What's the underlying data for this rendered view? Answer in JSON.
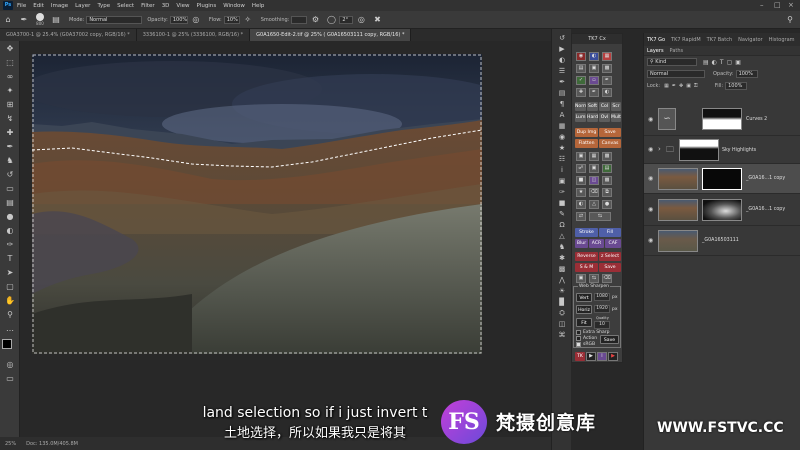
{
  "menu": {
    "items": [
      "File",
      "Edit",
      "Image",
      "Layer",
      "Type",
      "Select",
      "Filter",
      "3D",
      "View",
      "Plugins",
      "Window",
      "Help"
    ]
  },
  "options": {
    "mode_label": "Mode:",
    "mode_value": "Normal",
    "opacity_label": "Opacity:",
    "opacity_value": "100%",
    "flow_label": "Flow:",
    "flow_value": "10%",
    "smoothing_label": "Smoothing:",
    "angle_value": "2°",
    "brush_size": "800"
  },
  "tabs": [
    {
      "label": "G0A3700-1 @ 25.4% (G0A37002 copy, RGB/16) *",
      "active": false
    },
    {
      "label": "3336100-1 @ 25% (3336100, RGB/16) *",
      "active": false
    },
    {
      "label": "G0A1650-Edit-2.tif @ 25% ( G0A16503111 copy, RGB/16) *",
      "active": true
    }
  ],
  "status": {
    "zoom": "25%",
    "doc": "Doc: 135.0M/405.8M"
  },
  "subtitles": {
    "en": "land selection so if i just invert t",
    "zh": "土地选择，所以如果我只是将其"
  },
  "tk_cx": {
    "title": "TK7 Cx",
    "rows": [
      [
        "Norm",
        "Soft",
        "Col",
        "Scr"
      ],
      [
        "Lum",
        "Hard",
        "Ovl",
        "Mult"
      ]
    ],
    "dup_img": "Dup Img",
    "save_btn": "Save",
    "flatten": "Flatten",
    "canvas": "Canvas",
    "stroke": "Stroke",
    "fill": "Fill",
    "blur": "Blur",
    "acr": "ACR",
    "caf": "CAF",
    "reverse": "Reverse",
    "z_select": "z Select",
    "sm": "S & M",
    "save2": "Save"
  },
  "web_sharpen": {
    "title": "Web Sharpen",
    "vert_label": "Vert",
    "vert_value": "1080",
    "horiz_label": "Horiz",
    "horiz_value": "1920",
    "fit_label": "Fit",
    "quality_label": "Quality",
    "quality_value": "10",
    "px": "px",
    "extra_sharp": "Extra Sharp",
    "action": "Action",
    "srgb": "sRGB",
    "save": "Save"
  },
  "right_panel": {
    "top_tabs": [
      "TK7 Go",
      "TK7 RapidM",
      "TK7 Batch",
      "Navigator",
      "Histogram"
    ],
    "sub_tabs": [
      "Layers",
      "Paths"
    ],
    "kind": "Kind",
    "blend": "Normal",
    "opacity_label": "Opacity:",
    "opacity_value": "100%",
    "lock_label": "Lock:",
    "fill_label": "Fill:",
    "fill_value": "100%",
    "layers": [
      {
        "name": "Curves 2"
      },
      {
        "name": "Sky Highlights"
      },
      {
        "name": "_G0A16...1 copy"
      },
      {
        "name": "_G0A16...1 copy"
      },
      {
        "name": "_G0A16503111"
      }
    ]
  },
  "watermark": {
    "logo": "FS",
    "text": "梵摄创意库",
    "url": "WWW.FSTVC.CC"
  }
}
